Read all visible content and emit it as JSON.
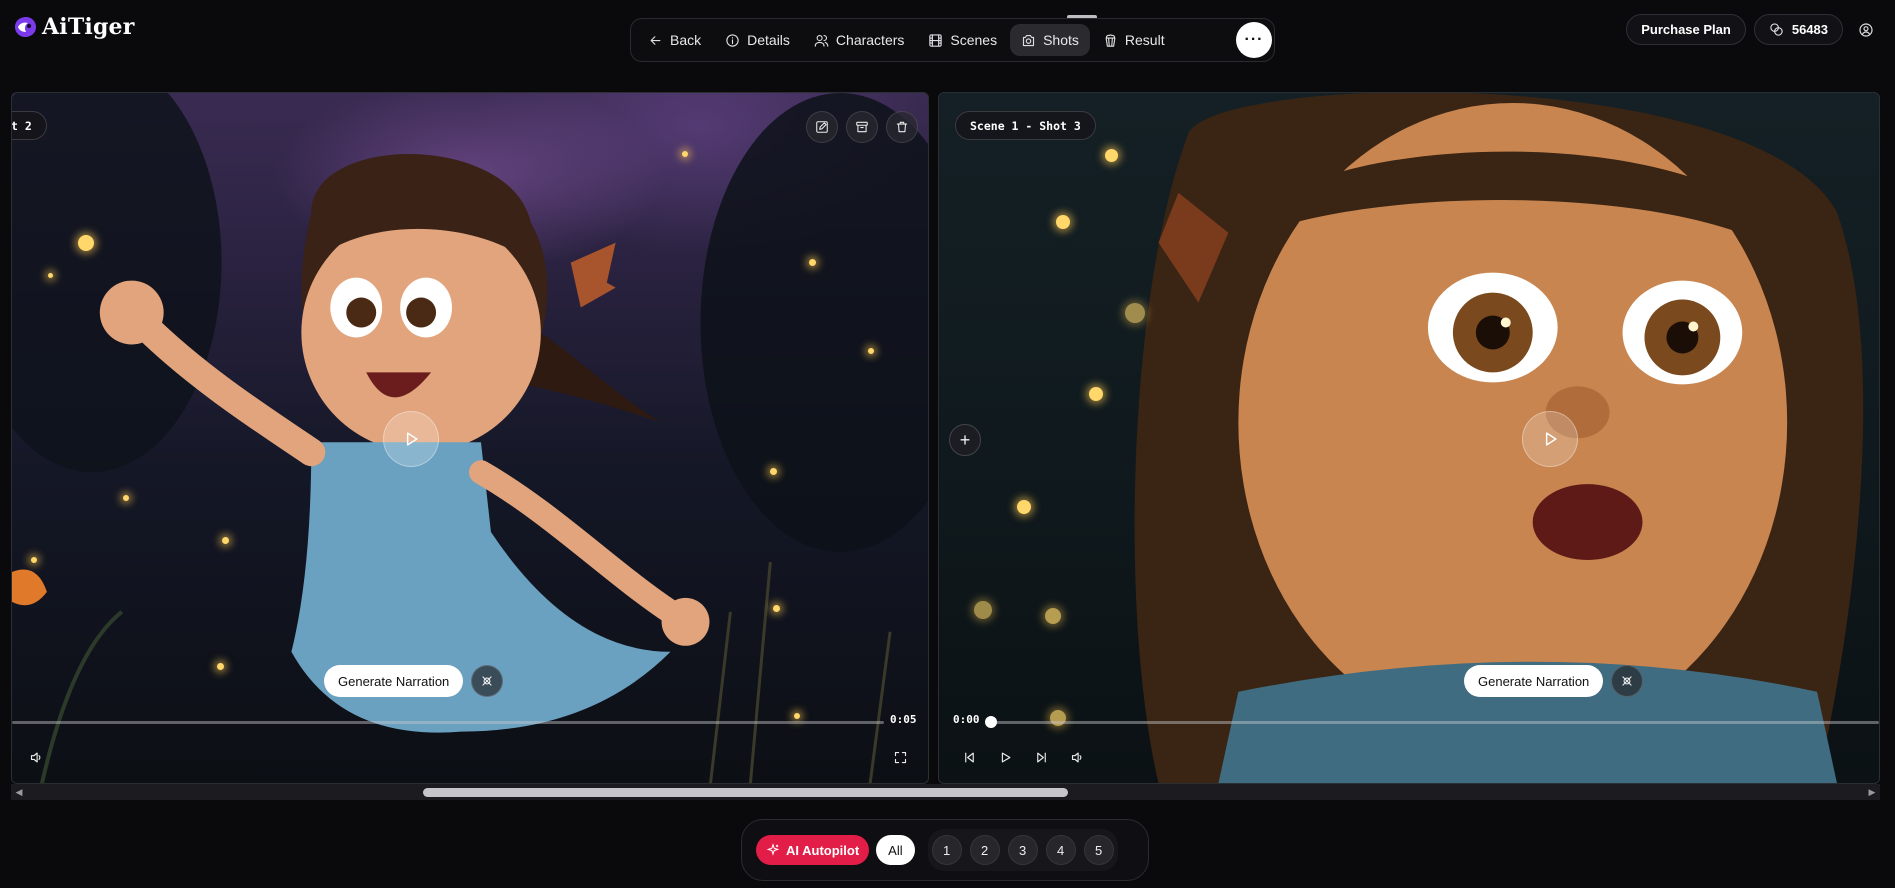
{
  "app": {
    "name": "AiTiger"
  },
  "nav": {
    "items": [
      {
        "label": "Back",
        "icon": "arrow-left-icon"
      },
      {
        "label": "Details",
        "icon": "info-icon"
      },
      {
        "label": "Characters",
        "icon": "users-icon"
      },
      {
        "label": "Scenes",
        "icon": "film-icon"
      },
      {
        "label": "Shots",
        "icon": "camera-icon",
        "active": true
      },
      {
        "label": "Result",
        "icon": "popcorn-icon"
      }
    ],
    "more_label": "···"
  },
  "header": {
    "purchase_label": "Purchase Plan",
    "credits": "56483"
  },
  "panels": {
    "left": {
      "label": "t 2",
      "narration_label": "Generate Narration",
      "duration": "0:05",
      "progress_fraction": 1.0
    },
    "right": {
      "label": "Scene 1 - Shot 3",
      "narration_label": "Generate Narration",
      "current_time": "0:00",
      "progress_fraction": 0.0,
      "add_label": "+"
    }
  },
  "scrollbar": {
    "left_arrow": "◀",
    "right_arrow": "▶"
  },
  "bottom_bar": {
    "autopilot_label": "AI Autopilot",
    "all_label": "All",
    "pages": [
      "1",
      "2",
      "3",
      "4",
      "5"
    ]
  },
  "colors": {
    "accent": "#e11d48",
    "background": "#0a0a0d"
  }
}
